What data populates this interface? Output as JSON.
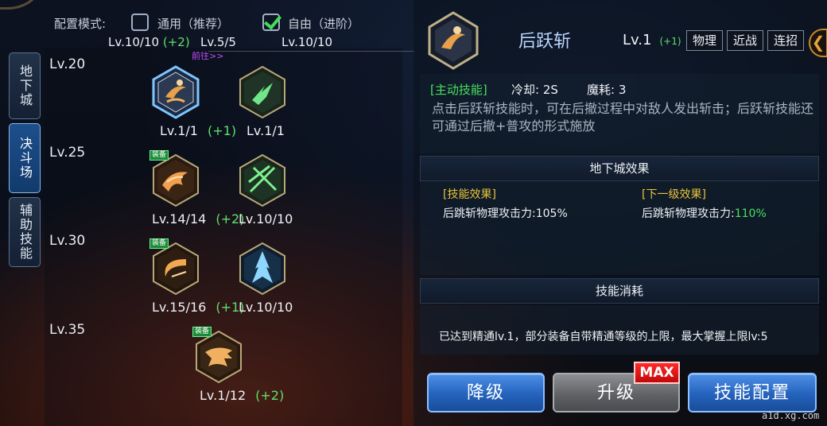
{
  "config": {
    "label": "配置模式:",
    "option_general": "通用（推荐）",
    "option_free": "自由（进阶）",
    "general_checked": false,
    "free_checked": true
  },
  "top_levels": {
    "lv_a": "Lv.10/10",
    "lv_a_plus": "(+2)",
    "lv_b": "Lv.5/5",
    "lv_c": "Lv.10/10",
    "goto": "前往>>"
  },
  "tabs": [
    {
      "label": "地下城",
      "active": false
    },
    {
      "label": "决斗场",
      "active": true
    },
    {
      "label": "辅助技能",
      "active": false
    }
  ],
  "tiers": [
    "Lv.20",
    "Lv.25",
    "Lv.30",
    "Lv.35"
  ],
  "skills": [
    {
      "level": "Lv.1/1",
      "plus": "(+1)",
      "badge": "",
      "icon": "back-jump-slash-icon",
      "selected": true
    },
    {
      "level": "Lv.1/1",
      "plus": "",
      "badge": "",
      "icon": "green-slash-icon",
      "selected": false
    },
    {
      "level": "Lv.14/14",
      "plus": "(+2)",
      "badge": "装备",
      "icon": "flame-burst-icon",
      "selected": false
    },
    {
      "level": "Lv.10/10",
      "plus": "",
      "badge": "",
      "icon": "crossed-blades-icon",
      "selected": false
    },
    {
      "level": "Lv.15/16",
      "plus": "(+1)",
      "badge": "装备",
      "icon": "crescent-slash-icon",
      "selected": false
    },
    {
      "level": "Lv.10/10",
      "plus": "",
      "badge": "",
      "icon": "ice-spike-icon",
      "selected": false
    },
    {
      "level": "Lv.1/12",
      "plus": "(+2)",
      "badge": "装备",
      "icon": "beast-fury-icon",
      "selected": false
    }
  ],
  "detail": {
    "name": "后跃斩",
    "level": "Lv.1",
    "level_plus": "(+1)",
    "tags": [
      "物理",
      "近战",
      "连招"
    ],
    "type": "[主动技能]",
    "cooldown": "冷却: 2S",
    "mana": "魔耗: 3",
    "description": "点击后跃斩技能时，可在后撤过程中对敌人发出斩击；后跃斩技能还可通过后撤+普攻的形式施放",
    "dungeon_section": "地下城效果",
    "effect_header": "[技能效果]",
    "effect_value_label": "后跳斩物理攻击力:",
    "effect_value": "105%",
    "next_header": "[下一级效果]",
    "next_value_label": "后跳斩物理攻击力:",
    "next_value": "110%",
    "cost_section": "技能消耗",
    "cost_text": "已达到精通lv.1，部分装备自带精通等级的上限，最大掌握上限lv:5"
  },
  "buttons": {
    "downgrade": "降级",
    "upgrade": "升级",
    "max": "MAX",
    "config": "技能配置"
  },
  "watermark": "a1d.xg.com",
  "colors": {
    "accent_green": "#48e060",
    "title_blue": "#b9d6ff",
    "button_blue": "#2463bd",
    "max_red": "#e01010"
  }
}
